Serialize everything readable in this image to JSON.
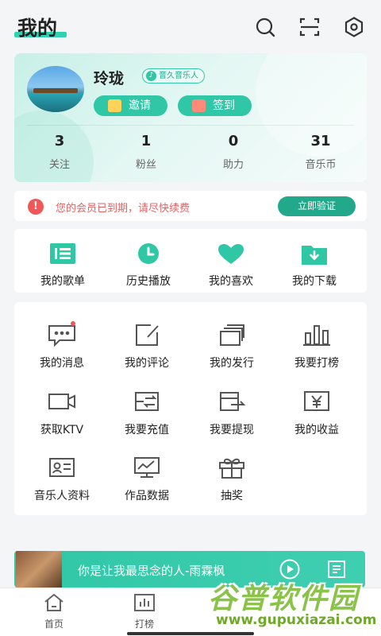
{
  "header": {
    "title": "我的",
    "icons": [
      "search-icon",
      "scan-icon",
      "settings-icon"
    ]
  },
  "profile": {
    "username": "玲珑",
    "tag": "音久音乐人",
    "invite_label": "邀请",
    "checkin_label": "签到",
    "stats": [
      {
        "value": "3",
        "label": "关注"
      },
      {
        "value": "1",
        "label": "粉丝"
      },
      {
        "value": "0",
        "label": "助力"
      },
      {
        "value": "31",
        "label": "音乐币"
      }
    ]
  },
  "notice": {
    "text": "您的会员已到期，请尽快续费",
    "action": "立即验证"
  },
  "quick": [
    {
      "label": "我的歌单",
      "icon": "playlist-icon"
    },
    {
      "label": "历史播放",
      "icon": "clock-icon"
    },
    {
      "label": "我的喜欢",
      "icon": "heart-icon"
    },
    {
      "label": "我的下载",
      "icon": "download-folder-icon"
    }
  ],
  "grid": [
    {
      "label": "我的消息",
      "icon": "message-icon",
      "badge": true
    },
    {
      "label": "我的评论",
      "icon": "edit-icon"
    },
    {
      "label": "我的发行",
      "icon": "release-icon"
    },
    {
      "label": "我要打榜",
      "icon": "chart-bars-icon"
    },
    {
      "label": "获取KTV",
      "icon": "video-camera-icon"
    },
    {
      "label": "我要充值",
      "icon": "recharge-icon"
    },
    {
      "label": "我要提现",
      "icon": "withdraw-icon"
    },
    {
      "label": "我的收益",
      "icon": "yuan-icon"
    },
    {
      "label": "音乐人资料",
      "icon": "id-card-icon"
    },
    {
      "label": "作品数据",
      "icon": "monitor-chart-icon"
    },
    {
      "label": "抽奖",
      "icon": "gift-icon"
    }
  ],
  "player": {
    "song": "你是让我最思念的人-雨霖枫"
  },
  "tabs": [
    {
      "label": "首页",
      "icon": "home-icon"
    },
    {
      "label": "打榜",
      "icon": "ranking-icon"
    }
  ],
  "watermark": {
    "title": "谷普软件园",
    "url": "www.gupuxiazai.com"
  },
  "colors": {
    "accent": "#2fc7a6",
    "accent_dark": "#22a98b",
    "warn": "#f25757"
  }
}
